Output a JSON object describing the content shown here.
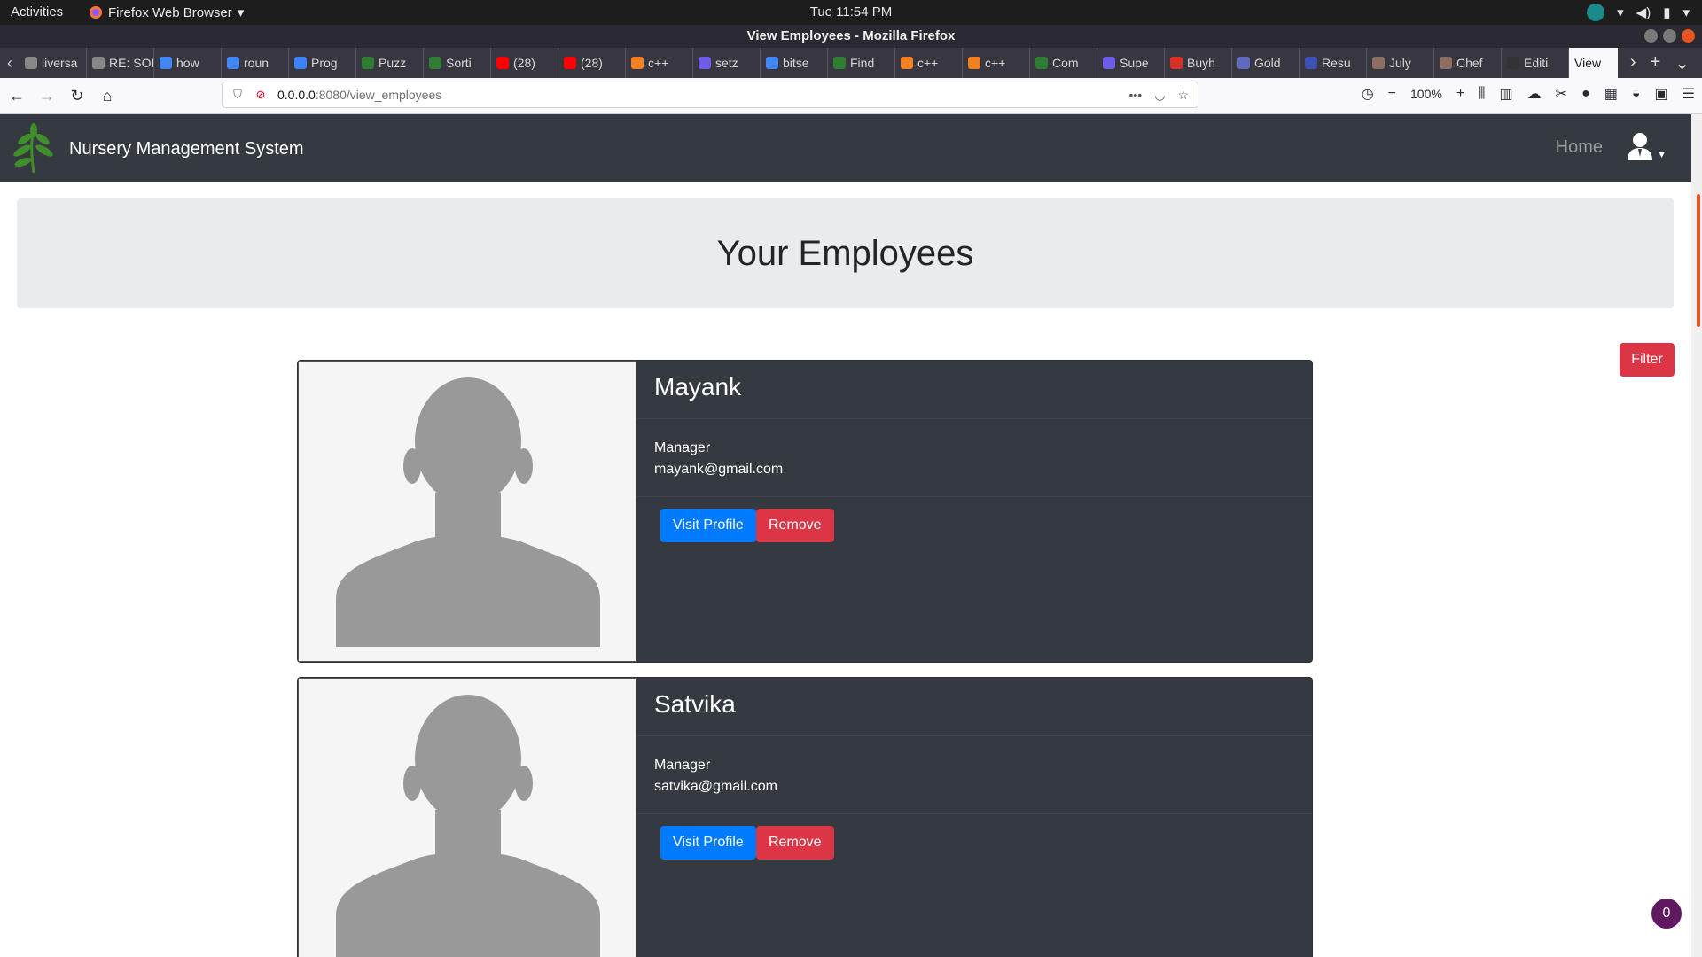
{
  "system_bar": {
    "activities": "Activities",
    "app_name": "Firefox Web Browser",
    "clock": "Tue 11:54 PM"
  },
  "browser": {
    "window_title": "View Employees - Mozilla Firefox",
    "tabs": [
      {
        "label": "iiversa",
        "color": "#888888"
      },
      {
        "label": "RE: SOP",
        "color": "#888888"
      },
      {
        "label": "how",
        "color": "#4285f4"
      },
      {
        "label": "roun",
        "color": "#4285f4"
      },
      {
        "label": "Prog",
        "color": "#3b82f6"
      },
      {
        "label": "Puzz",
        "color": "#2e7d32"
      },
      {
        "label": "Sorti",
        "color": "#2e7d32"
      },
      {
        "label": "(28)",
        "color": "#ff0000"
      },
      {
        "label": "(28)",
        "color": "#ff0000"
      },
      {
        "label": "c++",
        "color": "#f48024"
      },
      {
        "label": "setz",
        "color": "#6c5ce7"
      },
      {
        "label": "bitse",
        "color": "#4285f4"
      },
      {
        "label": "Find",
        "color": "#2e7d32"
      },
      {
        "label": "c++",
        "color": "#f48024"
      },
      {
        "label": "c++",
        "color": "#f48024"
      },
      {
        "label": "Com",
        "color": "#2e7d32"
      },
      {
        "label": "Supe",
        "color": "#6c5ce7"
      },
      {
        "label": "Buyh",
        "color": "#d93025"
      },
      {
        "label": "Gold",
        "color": "#5c6bc0"
      },
      {
        "label": "Resu",
        "color": "#3f51b5"
      },
      {
        "label": "July",
        "color": "#8d6e63"
      },
      {
        "label": "Chef",
        "color": "#8d6e63"
      },
      {
        "label": "Editi",
        "color": "#333333"
      }
    ],
    "active_tab": {
      "label": "View",
      "close": "✕"
    },
    "url_host": "0.0.0.0",
    "url_path": ":8080/view_employees",
    "zoom": "100%"
  },
  "app": {
    "brand": "Nursery Management System",
    "nav_home": "Home",
    "page_title": "Your Employees",
    "filter_label": "Filter",
    "employees": [
      {
        "name": "Mayank",
        "role": "Manager",
        "email": "mayank@gmail.com",
        "visit_label": "Visit Profile",
        "remove_label": "Remove"
      },
      {
        "name": "Satvika",
        "role": "Manager",
        "email": "satvika@gmail.com",
        "visit_label": "Visit Profile",
        "remove_label": "Remove"
      }
    ],
    "notification_count": "0"
  },
  "colors": {
    "navbar": "#343a40",
    "jumbotron": "#e9ecef",
    "primary": "#007bff",
    "danger": "#dc3545",
    "leaf": "#3f8f2a"
  }
}
